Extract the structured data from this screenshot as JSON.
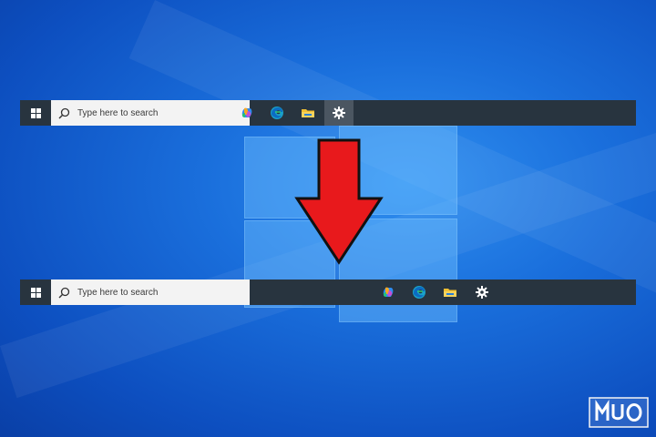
{
  "wallpaper": {
    "accent": "#1a6fdc"
  },
  "taskbar_before": {
    "search_placeholder": "Type here to search",
    "icons": [
      "copilot-icon",
      "edge-icon",
      "file-explorer-icon",
      "settings-gear-icon"
    ],
    "alignment": "left"
  },
  "taskbar_after": {
    "search_placeholder": "Type here to search",
    "icons": [
      "copilot-icon",
      "edge-icon",
      "file-explorer-icon",
      "settings-gear-icon"
    ],
    "alignment": "center"
  },
  "indicator": {
    "type": "down-arrow",
    "color": "#e8191c"
  },
  "watermark": {
    "text": "MUO"
  }
}
